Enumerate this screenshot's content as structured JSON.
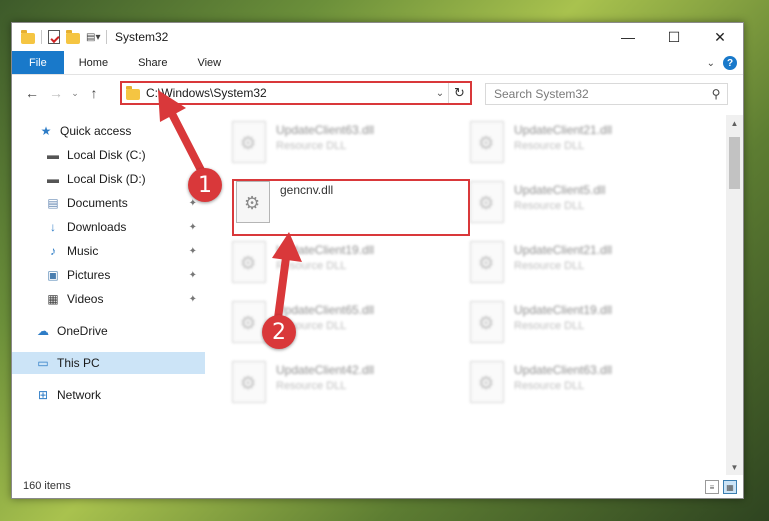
{
  "window": {
    "title": "System32",
    "controls": {
      "minimize": "—",
      "maximize": "☐",
      "close": "✕"
    }
  },
  "ribbon": {
    "tabs": [
      {
        "label": "File"
      },
      {
        "label": "Home"
      },
      {
        "label": "Share"
      },
      {
        "label": "View"
      }
    ],
    "help": "?"
  },
  "navbar": {
    "address": "C:\\Windows\\System32",
    "search_placeholder": "Search System32"
  },
  "sidebar": {
    "items": [
      {
        "label": "Quick access",
        "icon": "star-icon"
      },
      {
        "label": "Local Disk (C:)",
        "icon": "drive-icon"
      },
      {
        "label": "Local Disk (D:)",
        "icon": "drive-icon"
      },
      {
        "label": "Documents",
        "icon": "documents-icon"
      },
      {
        "label": "Downloads",
        "icon": "downloads-icon"
      },
      {
        "label": "Music",
        "icon": "music-icon"
      },
      {
        "label": "Pictures",
        "icon": "pictures-icon"
      },
      {
        "label": "Videos",
        "icon": "videos-icon"
      },
      {
        "label": "OneDrive",
        "icon": "cloud-icon"
      },
      {
        "label": "This PC",
        "icon": "computer-icon"
      },
      {
        "label": "Network",
        "icon": "network-icon"
      }
    ]
  },
  "files": [
    {
      "name": "UpdateClient63.dll",
      "type": "Resource DLL"
    },
    {
      "name": "UpdateClient21.dll",
      "type": "Resource DLL"
    },
    {
      "name": "gencnv.dll",
      "type": ""
    },
    {
      "name": "UpdateClient5.dll",
      "type": "Resource DLL"
    },
    {
      "name": "UpdateClient19.dll",
      "type": "Resource DLL"
    },
    {
      "name": "UpdateClient21.dll",
      "type": "Resource DLL"
    },
    {
      "name": "UpdateClient65.dll",
      "type": "Resource DLL"
    },
    {
      "name": "UpdateClient19.dll",
      "type": "Resource DLL"
    },
    {
      "name": "UpdateClient42.dll",
      "type": "Resource DLL"
    },
    {
      "name": "UpdateClient63.dll",
      "type": "Resource DLL"
    }
  ],
  "status": {
    "items_count": "160 items"
  },
  "callouts": {
    "one": "1",
    "two": "2"
  },
  "colors": {
    "accent": "#1979ca",
    "highlight": "#d9383a",
    "selected": "#cce4f7"
  }
}
